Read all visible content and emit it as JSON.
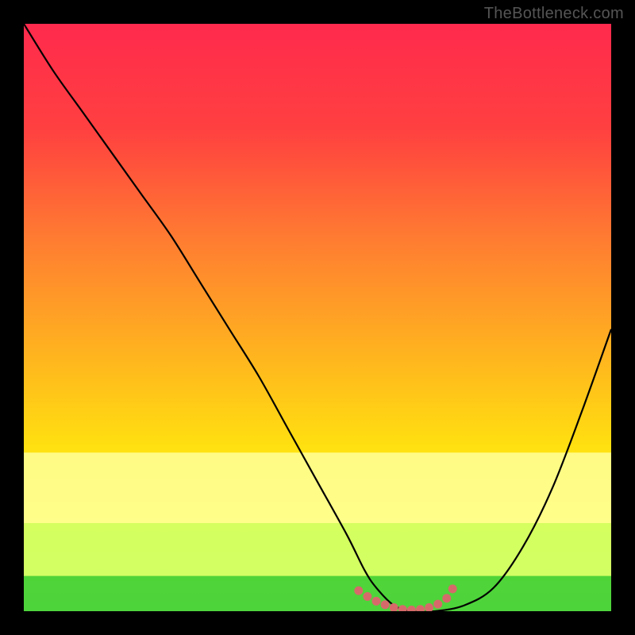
{
  "attribution": "TheBottleneck.com",
  "chart_data": {
    "type": "line",
    "title": "",
    "xlabel": "",
    "ylabel": "",
    "xlim": [
      0,
      100
    ],
    "ylim": [
      0,
      100
    ],
    "curve": {
      "x": [
        0,
        5,
        10,
        15,
        20,
        25,
        30,
        35,
        40,
        45,
        50,
        55,
        58,
        60,
        63,
        66,
        70,
        75,
        80,
        85,
        90,
        95,
        100
      ],
      "y": [
        100,
        92,
        85,
        78,
        71,
        64,
        56,
        48,
        40,
        31,
        22,
        13,
        7,
        4,
        1,
        0,
        0,
        1,
        4,
        11,
        21,
        34,
        48
      ]
    },
    "markers": {
      "x": [
        57,
        58.5,
        60,
        61.5,
        63,
        64.5,
        66,
        67.5,
        69,
        70.5,
        72,
        73
      ],
      "y": [
        3.5,
        2.5,
        1.7,
        1.1,
        0.6,
        0.3,
        0.2,
        0.3,
        0.6,
        1.2,
        2.2,
        3.8
      ]
    },
    "near_bottom_bands": [
      {
        "y_from": 73,
        "y_to": 85,
        "color": "#ffff99"
      },
      {
        "y_from": 85,
        "y_to": 94,
        "color": "#ccff66"
      },
      {
        "y_from": 94,
        "y_to": 100,
        "color": "#33cc33"
      }
    ]
  }
}
